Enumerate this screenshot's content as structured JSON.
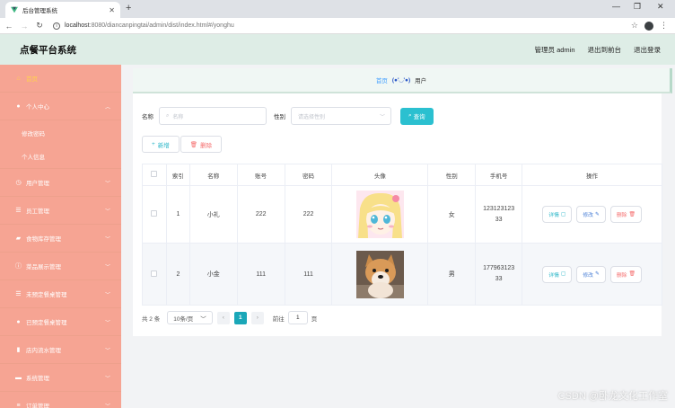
{
  "browser": {
    "tab_title": "后台管理系统",
    "url_host": "localhost",
    "url_rest": ":8080/diancanpingtai/admin/dist/index.html#/yonghu"
  },
  "header": {
    "brand": "点餐平台系统",
    "user": "管理员 admin",
    "back_front": "退出到前台",
    "logout": "退出登录"
  },
  "sidebar": {
    "items": [
      {
        "label": "首页",
        "icon": "home-icon",
        "active": true
      },
      {
        "label": "个人中心",
        "icon": "user-icon",
        "expanded": true
      },
      {
        "label": "修改密码",
        "sub": true
      },
      {
        "label": "个人信息",
        "sub": true
      },
      {
        "label": "用户管理",
        "icon": "clock-icon"
      },
      {
        "label": "员工管理",
        "icon": "list-icon"
      },
      {
        "label": "食物库存管理",
        "icon": "truck-icon"
      },
      {
        "label": "菜品展示管理",
        "icon": "info-icon"
      },
      {
        "label": "未预定餐桌管理",
        "icon": "list-icon"
      },
      {
        "label": "已预定餐桌管理",
        "icon": "user-icon"
      },
      {
        "label": "店内流水管理",
        "icon": "chart-icon"
      },
      {
        "label": "系统管理",
        "icon": "briefcase-icon"
      },
      {
        "label": "订单管理",
        "icon": "sliders-icon"
      }
    ]
  },
  "breadcrumb": {
    "home": "首页",
    "emoticon": "(●'◡'●)",
    "current": "用户"
  },
  "search": {
    "name_label": "名称",
    "name_placeholder": "名称",
    "gender_label": "性别",
    "gender_placeholder": "请选择性别",
    "query_button": "查询"
  },
  "actions": {
    "add": "新增",
    "delete": "删除"
  },
  "table": {
    "columns": [
      "索引",
      "名称",
      "账号",
      "密码",
      "头像",
      "性别",
      "手机号",
      "操作"
    ],
    "rows": [
      {
        "index": "1",
        "name": "小礼",
        "account": "222",
        "password": "222",
        "gender": "女",
        "phone_a": "123123123",
        "phone_b": "33"
      },
      {
        "index": "2",
        "name": "小金",
        "account": "111",
        "password": "111",
        "gender": "男",
        "phone_a": "177963123",
        "phone_b": "33"
      }
    ],
    "op_detail": "详情",
    "op_edit": "修改",
    "op_delete": "删除"
  },
  "pager": {
    "total": "共 2 条",
    "page_size": "10条/页",
    "current": "1",
    "goto_label": "前往",
    "goto_value": "1",
    "page_unit": "页"
  },
  "watermark": "CSDN @卧龙文化工作室",
  "colors": {
    "sidebar": "#f6a493",
    "header": "#deede6",
    "accent": "#2bc0d0"
  }
}
